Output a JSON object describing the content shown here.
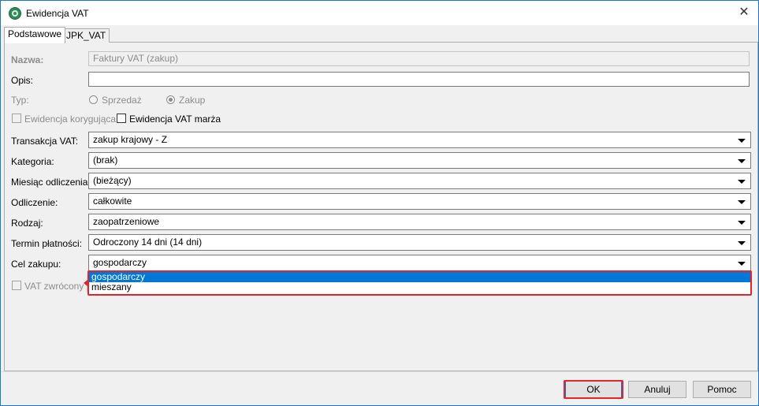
{
  "window": {
    "title": "Ewidencja VAT",
    "close_glyph": "✕"
  },
  "tabs": [
    {
      "label": "Podstawowe",
      "active": true
    },
    {
      "label": "JPK_VAT",
      "active": false
    }
  ],
  "form": {
    "nazwa": {
      "label": "Nazwa:",
      "value": "Faktury VAT (zakup)"
    },
    "opis": {
      "label": "Opis:",
      "value": ""
    },
    "typ": {
      "label": "Typ:",
      "options": [
        {
          "label": "Sprzedaż",
          "checked": false
        },
        {
          "label": "Zakup",
          "checked": true
        }
      ]
    },
    "ewidencja_korygujaca": {
      "label": "Ewidencja korygująca",
      "checked": false
    },
    "ewidencja_vat_marza": {
      "label": "Ewidencja VAT marża",
      "checked": false
    },
    "transakcja_vat": {
      "label": "Transakcja VAT:",
      "value": "zakup krajowy - Z"
    },
    "kategoria": {
      "label": "Kategoria:",
      "value": "(brak)"
    },
    "miesiac_odliczenia": {
      "label": "Miesiąc odliczenia:",
      "value": "(bieżący)"
    },
    "odliczenie": {
      "label": "Odliczenie:",
      "value": "całkowite"
    },
    "rodzaj": {
      "label": "Rodzaj:",
      "value": "zaopatrzeniowe"
    },
    "termin_platnosci": {
      "label": "Termin płatności:",
      "value": "Odroczony 14 dni (14 dni)"
    },
    "cel_zakupu": {
      "label": "Cel zakupu:",
      "value": "gospodarczy",
      "options": [
        "gospodarczy",
        "mieszany"
      ],
      "highlighted_option": "gospodarczy"
    },
    "vat_zwrocony": {
      "label": "VAT zwrócony p",
      "checked": false
    }
  },
  "buttons": {
    "ok": "OK",
    "cancel": "Anuluj",
    "help": "Pomoc"
  },
  "colors": {
    "accent": "#0078d7",
    "highlight": "#e0262b",
    "title_border": "#1979ca"
  }
}
